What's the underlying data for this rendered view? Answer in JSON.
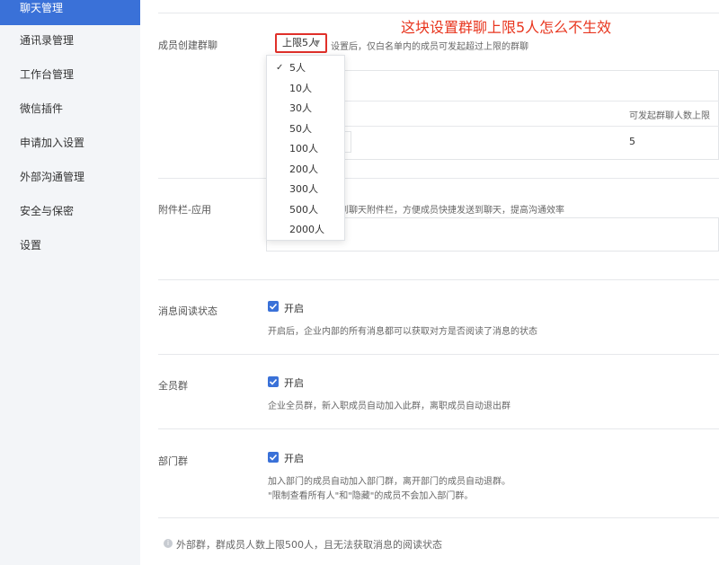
{
  "sidebar": {
    "items": [
      {
        "label": "聊天管理",
        "active": true
      },
      {
        "label": "通讯录管理"
      },
      {
        "label": "工作台管理"
      },
      {
        "label": "微信插件"
      },
      {
        "label": "申请加入设置"
      },
      {
        "label": "外部沟通管理"
      },
      {
        "label": "安全与保密"
      },
      {
        "label": "设置"
      }
    ]
  },
  "annotation": "这块设置群聊上限5人怎么不生效",
  "group_create": {
    "label": "成员创建群聊",
    "select_value": "上限5人",
    "description": "设置后，仅白名单内的成员可发起超过上限的群聊",
    "dropdown_options": [
      "5人",
      "10人",
      "30人",
      "50人",
      "100人",
      "200人",
      "300人",
      "500人",
      "2000人"
    ],
    "selected_option": "5人",
    "table_header": "可发起群聊人数上限",
    "table_value": "5"
  },
  "attachment": {
    "label": "附件栏-应用",
    "description": "置到聊天附件栏，方便成员快捷发送到聊天，提高沟通效率"
  },
  "read_status": {
    "label": "消息阅读状态",
    "toggle_label": "开启",
    "description": "开启后，企业内部的所有消息都可以获取对方是否阅读了消息的状态"
  },
  "all_staff_group": {
    "label": "全员群",
    "toggle_label": "开启",
    "description": "企业全员群，新入职成员自动加入此群，离职成员自动退出群"
  },
  "dept_group": {
    "label": "部门群",
    "toggle_label": "开启",
    "description_1": "加入部门的成员自动加入部门群，离开部门的成员自动退群。",
    "description_2": "\"限制查看所有人\"和\"隐藏\"的成员不会加入部门群。"
  },
  "footer": {
    "note": "外部群，群成员人数上限500人，且无法获取消息的阅读状态"
  },
  "colors": {
    "accent": "#3a71d8",
    "annotation_red": "#e8361f",
    "highlight_border": "#e0302a",
    "sidebar_bg": "#f3f5f8"
  }
}
